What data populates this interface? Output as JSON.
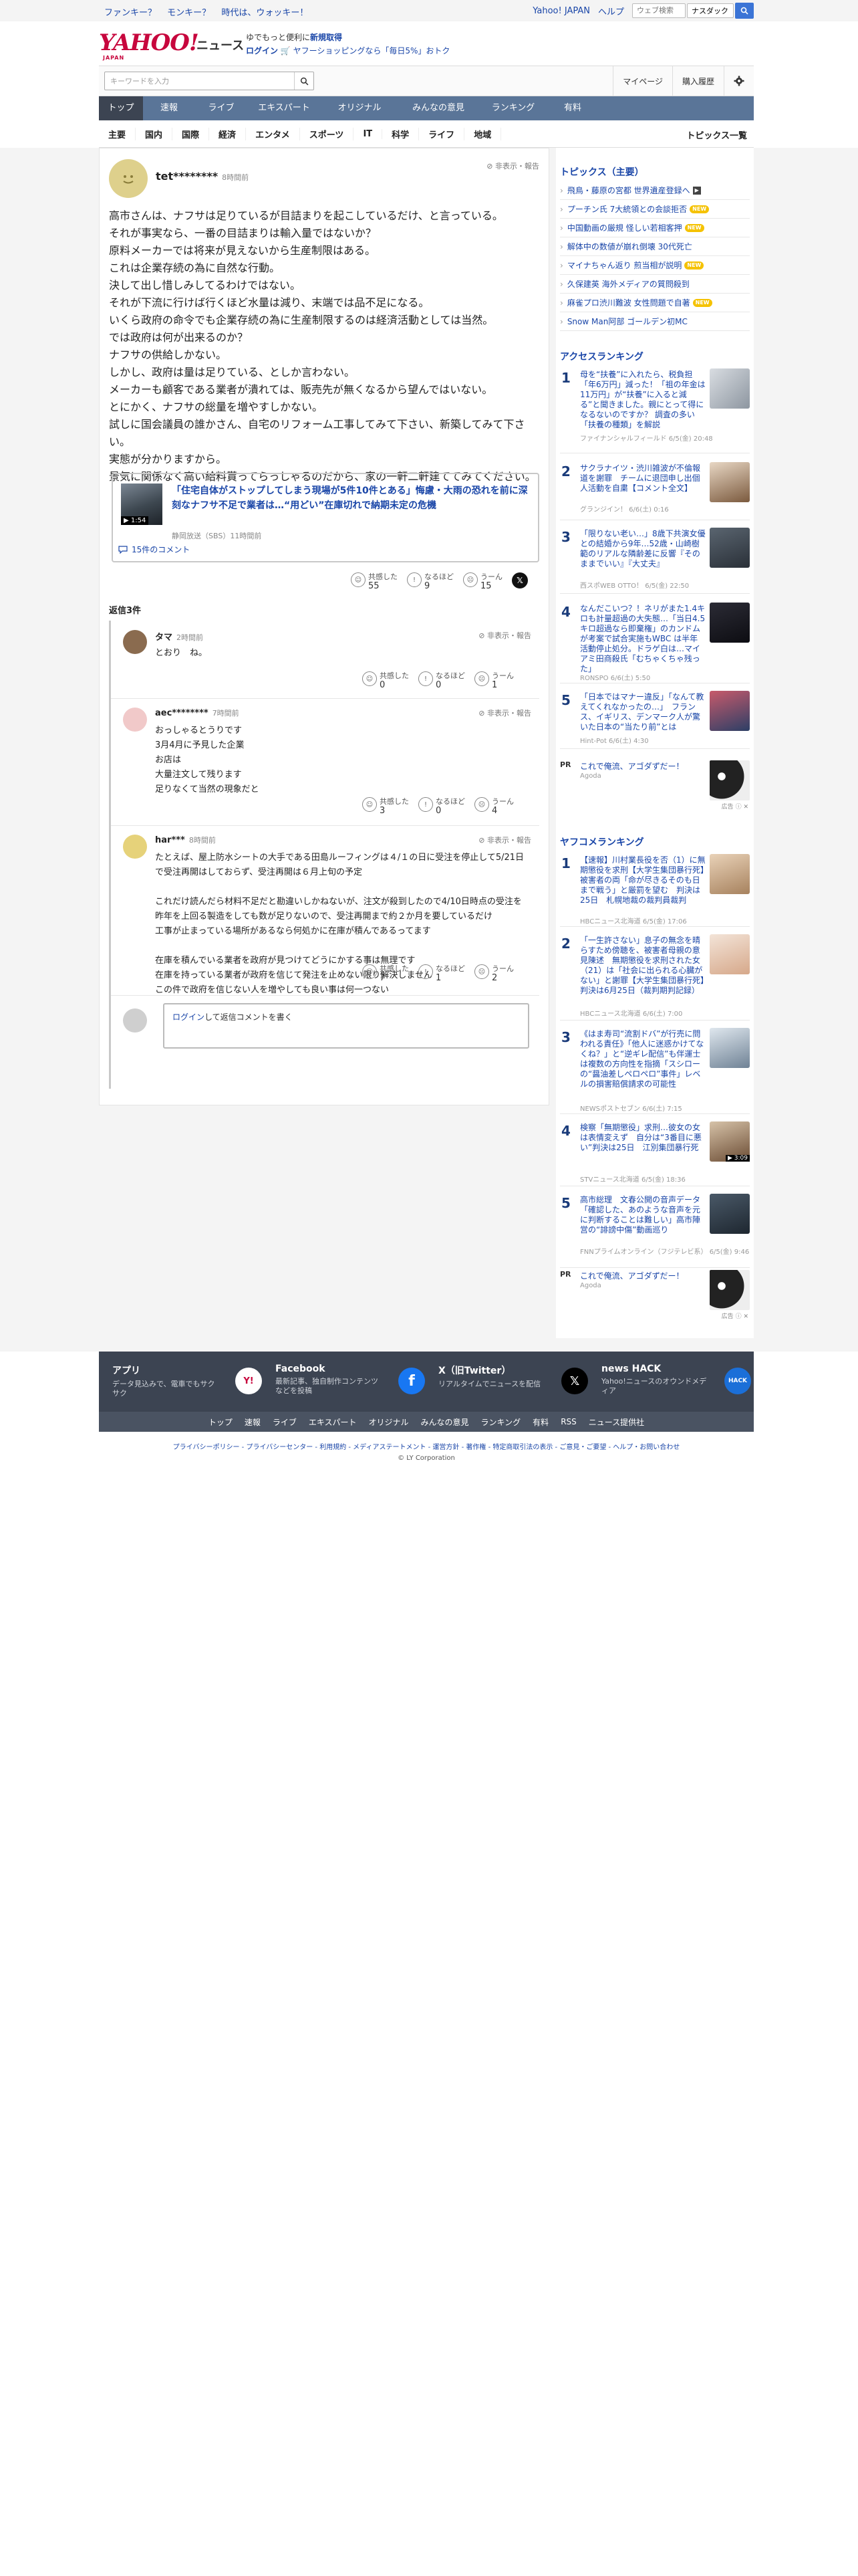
{
  "topbar": {
    "promo": [
      "ファンキー？",
      "モンキー？",
      "時代は、ウォッキー！"
    ],
    "links": [
      "Yahoo! JAPAN",
      "ヘルプ"
    ],
    "search_placeholder": "ウェブ検索",
    "search_value": "ナスダック 米..."
  },
  "header": {
    "logo": "YAHOO!",
    "logo_sub": "JAPAN",
    "section": "ニュース",
    "promo_line1_prefix": "ゆでもっと便利に",
    "promo_line1_link": "新規取得",
    "promo_login": "ログイン",
    "promo_line2": "ヤフーショッピングなら「毎日5%」おトク"
  },
  "search": {
    "placeholder": "キーワードを入力",
    "buttons": [
      "マイページ",
      "購入履歴"
    ]
  },
  "nav": {
    "items": [
      "トップ",
      "速報",
      "ライブ",
      "エキスパート",
      "オリジナル",
      "みんなの意見",
      "ランキング",
      "有料"
    ]
  },
  "subnav": {
    "items": [
      "主要",
      "国内",
      "国際",
      "経済",
      "エンタメ",
      "スポーツ",
      "IT",
      "科学",
      "ライフ",
      "地域"
    ],
    "topics_link": "トピックス一覧"
  },
  "comment": {
    "user": "tet********",
    "time": "8時間前",
    "report": "非表示・報告",
    "body": "高市さんは、ナフサは足りているが目詰まりを起こしているだけ、と言っている。\nそれが事実なら、一番の目詰まりは輸入量ではないか？\n原料メーカーでは将来が見えないから生産制限はある。\nこれは企業存続の為に自然な行動。\n決して出し惜しみしてるわけではない。\nそれが下流に行けば行くほど水量は減り、末端では品不足になる。\nいくら政府の命令でも企業存続の為に生産制限するのは経済活動としては当然。\nでは政府は何が出来るのか？\nナフサの供給しかない。\nしかし、政府は量は足りている、としか言わない。\nメーカーも顧客である業者が潰れては、販売先が無くなるから望んではいない。\nとにかく、ナフサの総量を増やすしかない。\n試しに国会議員の誰かさん、自宅のリフォーム工事してみて下さい、新築してみて下さい。\n実態が分かりますから。\n景気に関係なく高い給料貰ってらっしゃるのだから、家の一軒二軒建ててみてください。",
    "article": {
      "title": "「住宅自体がストップしてしまう現場が5件10件とある」悔慮・大雨の恐れを前に深刻なナフサ不足で業者は…“用どい”在庫切れで納期未定の危機",
      "meta": "静岡放送（SBS）11時間前",
      "duration": "1:54",
      "comments_link": "15件のコメント"
    },
    "reactions": [
      {
        "label": "共感した",
        "count": "55"
      },
      {
        "label": "なるほど",
        "count": "9"
      },
      {
        "label": "うーん",
        "count": "15"
      }
    ],
    "share": "𝕏"
  },
  "replies": {
    "count_label": "返信3件",
    "items": [
      {
        "user": "タマ",
        "time": "2時間前",
        "report": "非表示・報告",
        "text": "とおり　ね。",
        "reactions": [
          "0",
          "0",
          "1"
        ]
      },
      {
        "user": "aec********",
        "time": "7時間前",
        "report": "非表示・報告",
        "text": "おっしゃるとうりです\n3月4月に予見した企業\nお店は\n大量注文して残ります\n足りなくて当然の現象だと",
        "reactions": [
          "3",
          "0",
          "4"
        ]
      },
      {
        "user": "har***",
        "time": "8時間前",
        "report": "非表示・報告",
        "text": "たとえば、屋上防水シートの大手である田島ルーフィングは４/１の日に受注を停止して5/21日で受注再開はしておらず、受注再開は６月上旬の予定\n\nこれだけ読んだら材料不足だと勘違いしかねないが、注文が殺到したので4/10日時点の受注を昨年を上回る製造をしても数が足りないので、受注再開まで約２か月を要しているだけ\n工事が止まっている場所があるなら何処かに在庫が積んであるってます\n\n在庫を積んでいる業者を政府が見つけてどうにかする事は無理です\n在庫を持っている業者が政府を信じて発注を止めない限り解決しません\nこの件で政府を信じない人を増やしても良い事は何一つない",
        "reactions": [
          "7",
          "1",
          "2"
        ]
      }
    ],
    "reaction_labels": [
      "共感した",
      "なるほど",
      "うーん"
    ],
    "login_link": "ログイン",
    "login_text": "して返信コメントを書く"
  },
  "sidebar": {
    "topics_title": "トピックス（主要）",
    "topics": [
      {
        "text": "飛鳥・藤原の宮都 世界遺産登録へ",
        "badge": "video"
      },
      {
        "text": "プーチン氏 7大統領との会談拒否",
        "badge": "new"
      },
      {
        "text": "中国動画の厳規 怪しい若相客押",
        "badge": "new"
      },
      {
        "text": "解体中の数値が崩れ倒壊 30代死亡",
        "badge": ""
      },
      {
        "text": "マイナちゃん返り 煎当相が説明",
        "badge": "new"
      },
      {
        "text": "久保建英 海外メディアの質問殺到",
        "badge": ""
      },
      {
        "text": "麻雀プロ渋川難波 女性問題で自著",
        "badge": "new"
      },
      {
        "text": "Snow Man阿部 ゴールデン初MC",
        "badge": ""
      }
    ],
    "access_title": "アクセスランキング",
    "access": [
      {
        "rank": "1",
        "title": "母を“扶養”に入れたら、税負担「年6万円」減った！「祖の年金は11万円」が“扶養”に入ると減る”と聞きました。親にとって得になるないのですか？ 調査の多い「扶養の種類」を解説",
        "src": "ファイナンシャルフィールド 6/5(金) 20:48",
        "video": ""
      },
      {
        "rank": "2",
        "title": "サクラナイツ・渋川雑波が不倫報道を謝罪　チームに退団申し出個人活動を自粛【コメント全文】",
        "src": "グランジイン！ 6/6(土) 0:16",
        "video": ""
      },
      {
        "rank": "3",
        "title": "「限りない老い…」8歳下共演女優との結婚から9年…52歳・山崎樹範のリアルな隣齢差に反響『そのままでいい』『大丈夫』",
        "src": "西スポWEB OTTO！ 6/5(金) 22:50",
        "video": ""
      },
      {
        "rank": "4",
        "title": "なんだこいつ？！ネリがまた1.4キロも計量超過の大失態…「当日4.5キロ超過なら即棄権」のカンドムが考案で試合実施もWBC は半年活動停止処分。ドラゲ白は…マイアミ田商殺氏「むちゃくちゃ残った」",
        "src": "RONSPO 6/6(土) 5:50",
        "video": ""
      },
      {
        "rank": "5",
        "title": "「日本ではマナー違反」「なんて教えてくれなかったの…」　フランス、イギリス、デンマーク人が驚いた日本の“当たり前”とは",
        "src": "Hint-Pot 6/6(土) 4:30",
        "video": ""
      }
    ],
    "pr": {
      "label": "PR",
      "title": "これで俺流、アゴダずだー！",
      "sponsor": "Agoda",
      "ad": "広告"
    },
    "comment_title": "ヤフコメランキング",
    "comments": [
      {
        "rank": "1",
        "title": "【速報】川村業長役を否（1）に無期懲役を求刑【大学生集団暴行死】被害者の両「命が尽きるそのも日まで戦う」と厳罰を望む　判決は25日　札幌地裁の裁判員裁判",
        "src": "HBCニュース北海道 6/5(金) 17:06",
        "video": ""
      },
      {
        "rank": "2",
        "title": "「一生許さない」息子の無念を晴らすため傍聴を、被害者母親の意見陳述　無期懲役を求刑された女（21）は「社会に出られる心臓がない」と謝罪【大学生集団暴行死】判決は6月25日（裁判期判記録）",
        "src": "HBCニュース北海道 6/6(土) 7:00",
        "video": ""
      },
      {
        "rank": "3",
        "title": "《はま寿司“流割ドバ”が行売に問われる責任》「他人に迷惑かけてなくね？」と“逆ギレ配信”も伴運士は複数の方向性を指摘「スシローの“醤油差しペロペロ”事件」レベルの損害賠償請求の可能性",
        "src": "NEWSポストセブン 6/6(土) 7:15",
        "video": ""
      },
      {
        "rank": "4",
        "title": "検察「無期懲役」求刑…彼女の女は表情変えず　自分は“3番目に悪い”判決は25日　江別集団暴行死",
        "src": "STVニュース北海道 6/5(金) 18:36",
        "video": "3:09"
      },
      {
        "rank": "5",
        "title": "高市総理　文春公開の音声データ「確認した、あのような音声を元に判断することは難しい」高市陣営の“誹謗中傷”動画巡り",
        "src": "FNNプライムオンライン（フジテレビ系） 6/5(金) 9:46",
        "video": ""
      }
    ]
  },
  "footer": {
    "cols": [
      {
        "title": "アプリ",
        "desc": "データ見込みで、電車でもサクサク",
        "icon": "Y!"
      },
      {
        "title": "Facebook",
        "desc": "最新記事、独自制作コンテンツなどを投稿",
        "icon": "f"
      },
      {
        "title": "X（旧Twitter）",
        "desc": "リアルタイムでニュースを配信",
        "icon": "𝕏"
      },
      {
        "title": "news HACK",
        "desc": "Yahoo!ニュースのオウンドメディア",
        "icon": "HACK"
      }
    ],
    "links": [
      "トップ",
      "速報",
      "ライブ",
      "エキスパート",
      "オリジナル",
      "みんなの意見",
      "ランキング",
      "有料",
      "RSS",
      "ニュース提供社"
    ],
    "legal": "プライバシーポリシー - プライバシーセンター - 利用規約 - メディアステートメント - 運営方針 - 著作権 - 特定商取引法の表示 - ご意見・ご要望 - ヘルプ・お問い合わせ",
    "copyright": "© LY Corporation"
  },
  "colors": {
    "brand": "#c7063d",
    "nav": "#5a7598",
    "nav_active": "#3c4452",
    "link": "#1a46a8"
  }
}
